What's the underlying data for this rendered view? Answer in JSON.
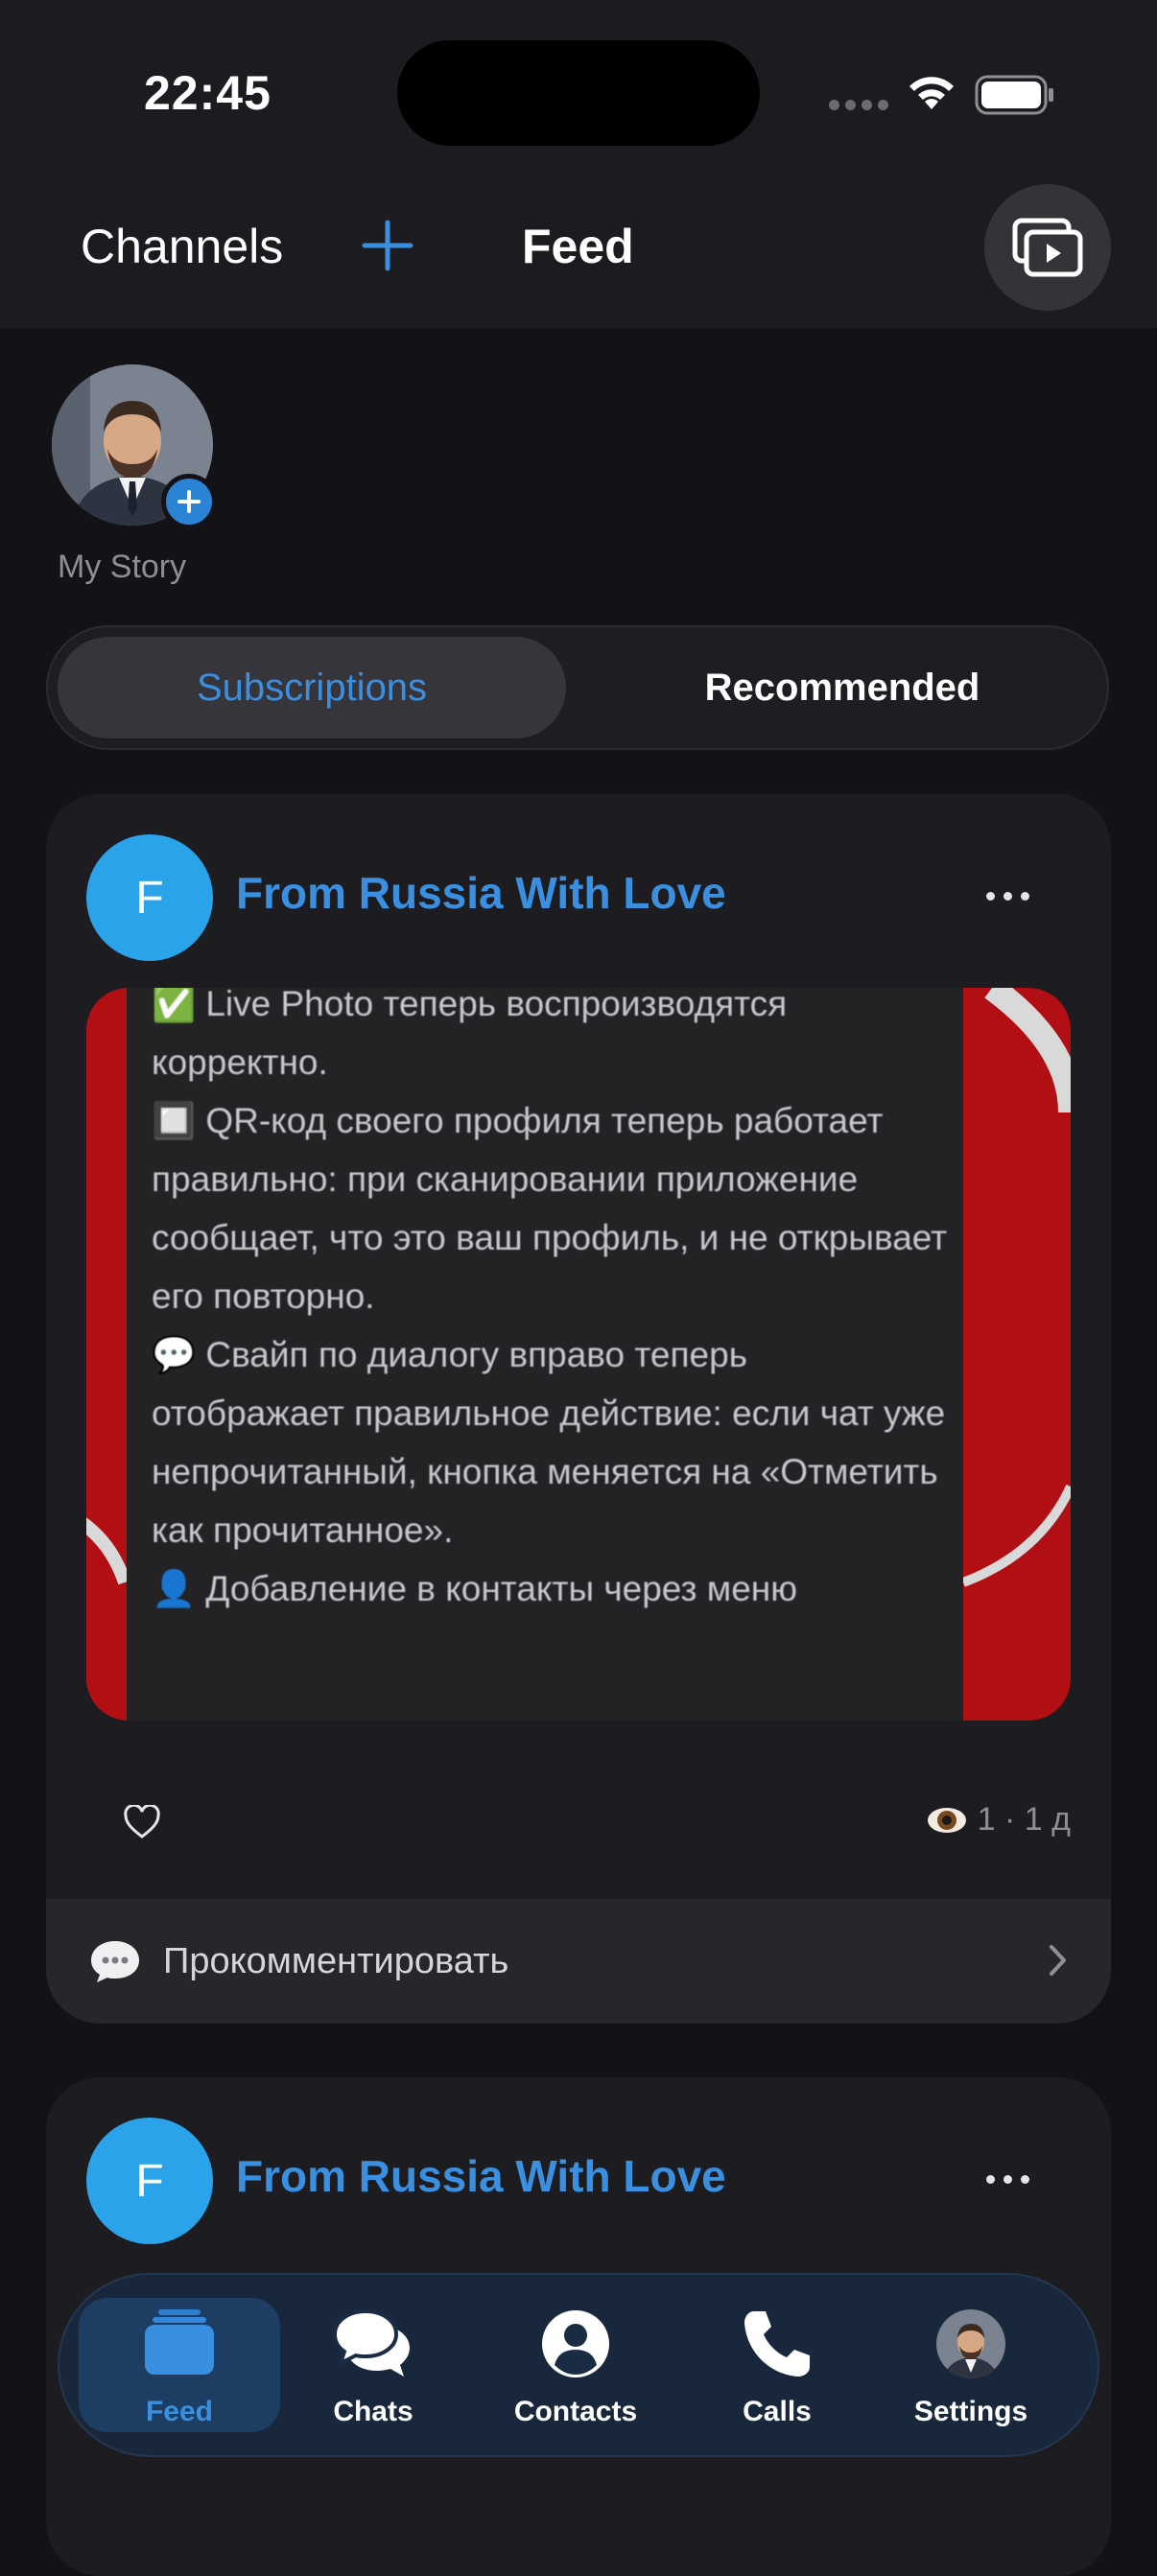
{
  "status": {
    "time": "22:45"
  },
  "header": {
    "channels_label": "Channels",
    "feed_label": "Feed"
  },
  "story": {
    "label": "My Story"
  },
  "segments": {
    "active": "Subscriptions",
    "other": "Recommended"
  },
  "posts": [
    {
      "avatar_letter": "F",
      "channel": "From Russia With Love",
      "text": "✅ Live Photo теперь воспроизводятся корректно.\n🔲 QR-код своего профиля теперь работает правильно: при сканировании приложение сообщает, что это ваш профиль, и не открывает его повторно.\n💬 Свайп по диалогу вправо теперь отображает правильное действие: если чат уже непрочитанный, кнопка меняется на «Отметить как прочитанное».\n👤 Добавление в контакты через меню",
      "views": "1",
      "age": "1 д",
      "stats_text": "1 · 1 д",
      "comment_label": "Прокомментировать"
    },
    {
      "avatar_letter": "F",
      "channel": "From Russia With Love"
    }
  ],
  "tabbar": {
    "items": [
      {
        "label": "Feed",
        "icon": "feed-icon",
        "active": true
      },
      {
        "label": "Chats",
        "icon": "chats-icon"
      },
      {
        "label": "Contacts",
        "icon": "contacts-icon"
      },
      {
        "label": "Calls",
        "icon": "calls-icon"
      },
      {
        "label": "Settings",
        "icon": "settings-avatar-icon"
      }
    ]
  },
  "colors": {
    "accent": "#3a8fe0",
    "channel_avatar": "#2aa3ea",
    "background": "#121217",
    "card": "#1c1c21"
  }
}
